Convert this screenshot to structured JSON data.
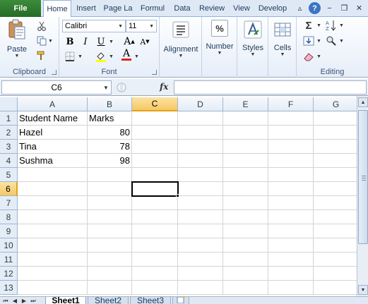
{
  "tabs": {
    "file": "File",
    "items": [
      "Home",
      "Insert",
      "Page La",
      "Formul",
      "Data",
      "Review",
      "View",
      "Develop"
    ]
  },
  "ribbon": {
    "paste": "Paste",
    "font_name": "Calibri",
    "font_size": "11",
    "bold": "B",
    "italic": "I",
    "underline": "U",
    "grow_font": "A",
    "shrink_font": "A",
    "font_color_glyph": "A",
    "alignment": "Alignment",
    "number": "Number",
    "number_glyph": "%",
    "styles": "Styles",
    "cells": "Cells",
    "sum_glyph": "Σ",
    "groups": {
      "clipboard": "Clipboard",
      "font": "Font",
      "editing": "Editing"
    }
  },
  "formula_bar": {
    "name_box": "C6",
    "fx": "fx",
    "value": ""
  },
  "grid": {
    "columns": [
      "A",
      "B",
      "C",
      "D",
      "E",
      "F",
      "G"
    ],
    "rows": [
      "1",
      "2",
      "3",
      "4",
      "5",
      "6",
      "7",
      "8",
      "9",
      "10",
      "11",
      "12",
      "13"
    ],
    "selected_column": "C",
    "selected_row": "6",
    "cells": {
      "A1": "Student Name",
      "B1": "Marks",
      "A2": "Hazel",
      "B2": "80",
      "A3": "Tina",
      "B3": "78",
      "A4": "Sushma",
      "B4": "98"
    }
  },
  "sheets": {
    "tabs": [
      "Sheet1",
      "Sheet2",
      "Sheet3"
    ],
    "active": "Sheet1"
  },
  "colors": {
    "file_tab": "#2d7a2d",
    "selection_header": "#f6c862",
    "gridline": "#d4d4d4"
  }
}
